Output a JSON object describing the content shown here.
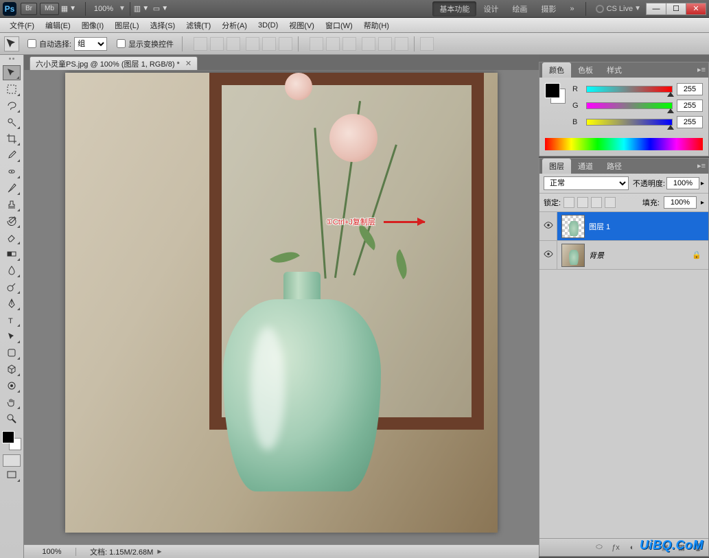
{
  "app_logo": "Ps",
  "topbar": {
    "br": "Br",
    "mb": "Mb",
    "zoom": "100%",
    "workspaces": [
      "基本功能",
      "设计",
      "绘画",
      "摄影"
    ],
    "active_workspace": 0,
    "more": "»",
    "cslive": "CS Live"
  },
  "menubar": [
    "文件(F)",
    "编辑(E)",
    "图像(I)",
    "图层(L)",
    "选择(S)",
    "滤镜(T)",
    "分析(A)",
    "3D(D)",
    "视图(V)",
    "窗口(W)",
    "帮助(H)"
  ],
  "options": {
    "auto_select": "自动选择:",
    "auto_select_value": "组",
    "show_transform": "显示变换控件"
  },
  "document": {
    "tab_title": "六小灵童PS.jpg @ 100% (图层 1, RGB/8) *"
  },
  "annotation": "①Ctrl+J复制层",
  "watermark": "UiBQ.CoM",
  "statusbar": {
    "zoom": "100%",
    "doc": "文档: 1.15M/2.68M"
  },
  "panels": {
    "color": {
      "tabs": [
        "颜色",
        "色板",
        "样式"
      ],
      "active": 0,
      "channels": [
        {
          "label": "R",
          "value": "255",
          "gradient": "r"
        },
        {
          "label": "G",
          "value": "255",
          "gradient": "g"
        },
        {
          "label": "B",
          "value": "255",
          "gradient": "b"
        }
      ]
    },
    "layers": {
      "tabs": [
        "图层",
        "通道",
        "路径"
      ],
      "active": 0,
      "blend_mode": "正常",
      "opacity_label": "不透明度:",
      "opacity_value": "100%",
      "lock_label": "锁定:",
      "fill_label": "填充:",
      "fill_value": "100%",
      "layers_list": [
        {
          "name": "图层 1",
          "selected": true,
          "locked": false,
          "thumb": "checker"
        },
        {
          "name": "背景",
          "selected": false,
          "locked": true,
          "thumb": "photo",
          "italic": true
        }
      ]
    }
  },
  "tools": [
    "move",
    "marquee",
    "lasso",
    "wand",
    "crop",
    "eyedropper",
    "healing",
    "brush",
    "stamp",
    "history-brush",
    "eraser",
    "gradient",
    "blur",
    "dodge",
    "pen",
    "type",
    "path-select",
    "shape",
    "3d",
    "hand",
    "zoom"
  ]
}
